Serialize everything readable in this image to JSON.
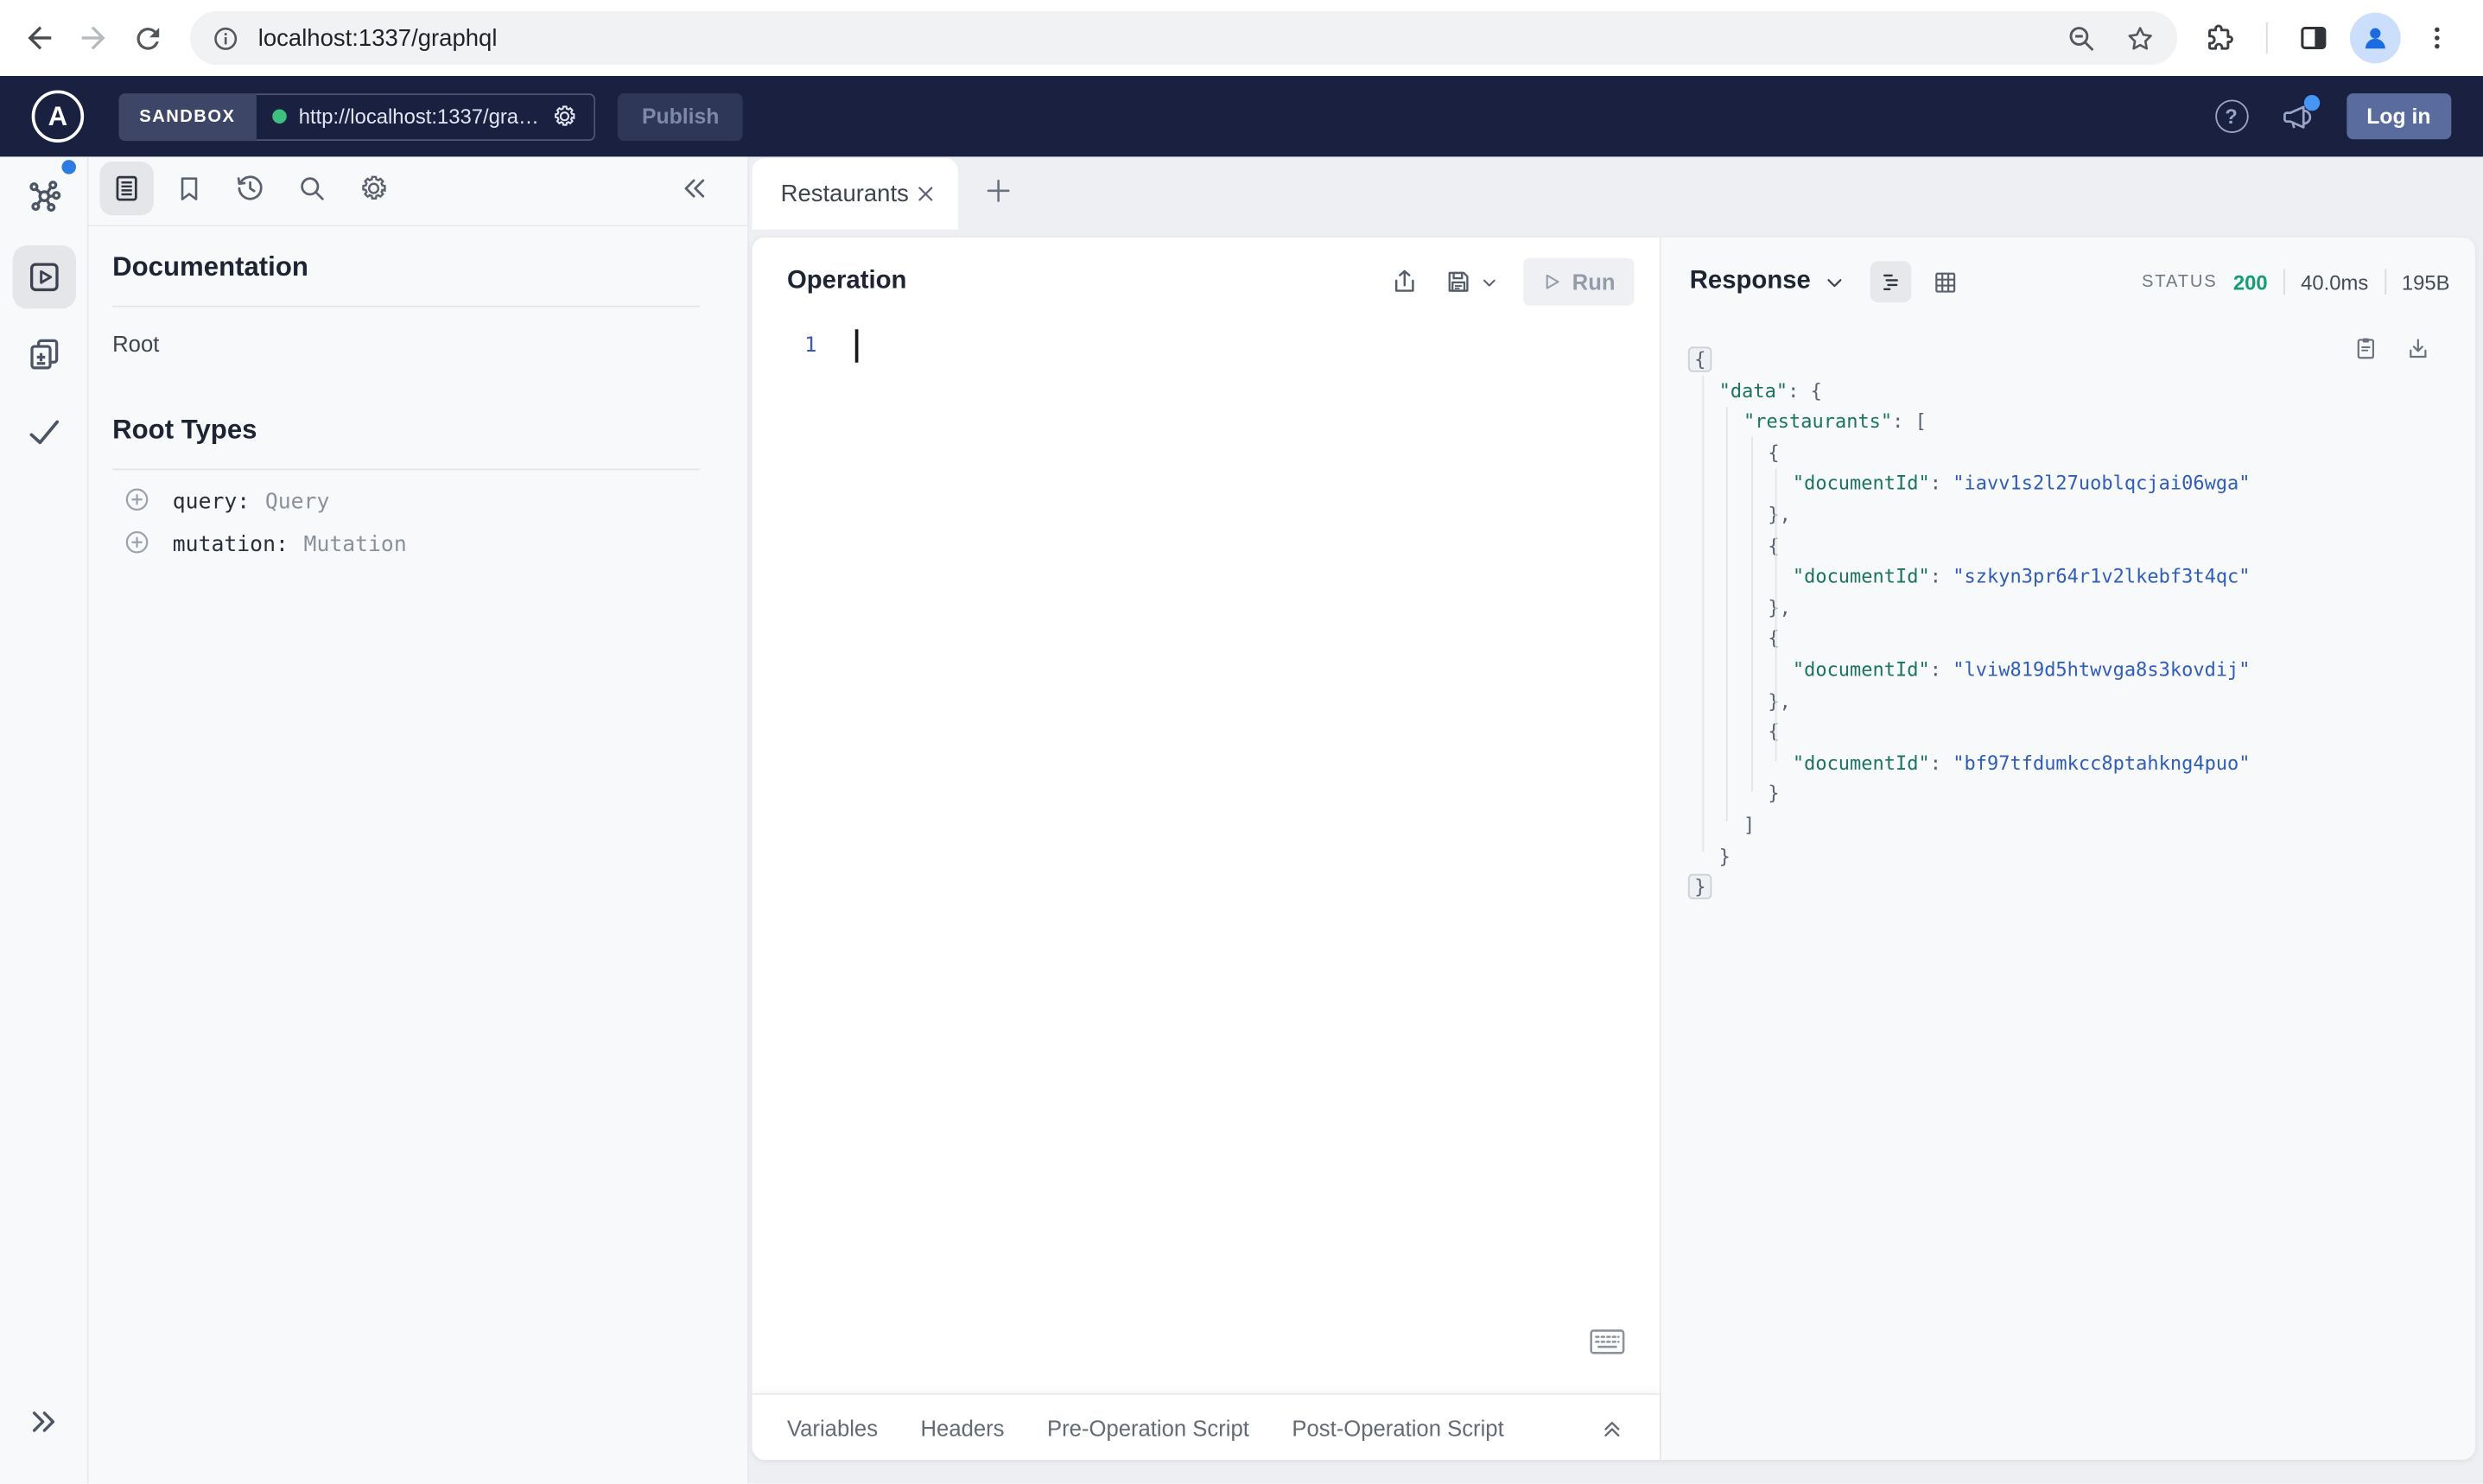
{
  "browser": {
    "url": "localhost:1337/graphql"
  },
  "apollo_bar": {
    "logo_letter": "A",
    "env_label": "SANDBOX",
    "endpoint_url": "http://localhost:1337/gra…",
    "publish_label": "Publish",
    "help_label": "?",
    "login_label": "Log in"
  },
  "docs_panel": {
    "title": "Documentation",
    "root_link": "Root",
    "root_types_title": "Root Types",
    "fields": [
      {
        "name": "query:",
        "type": "Query"
      },
      {
        "name": "mutation:",
        "type": "Mutation"
      }
    ]
  },
  "tabs": {
    "active_tab": "Restaurants"
  },
  "operation_panel": {
    "title": "Operation",
    "run_label": "Run",
    "line_number": "1",
    "drawer_tabs": [
      "Variables",
      "Headers",
      "Pre-Operation Script",
      "Post-Operation Script"
    ]
  },
  "response_panel": {
    "title": "Response",
    "status_label": "STATUS",
    "status_code": "200",
    "duration": "40.0ms",
    "size": "195B",
    "document_ids": [
      "iavv1s2l27uoblqcjai06wga",
      "szkyn3pr64r1v2lkebf3t4qc",
      "lviw819d5htwvga8s3kovdij",
      "bf97tfdumkcc8ptahkng4puo"
    ],
    "json_lines": [
      {
        "indent": 0,
        "fold": true,
        "t": [
          [
            "p",
            "{"
          ]
        ]
      },
      {
        "indent": 1,
        "t": [
          [
            "k",
            "\"data\""
          ],
          [
            "p",
            ": {"
          ]
        ]
      },
      {
        "indent": 2,
        "t": [
          [
            "k",
            "\"restaurants\""
          ],
          [
            "p",
            ": ["
          ]
        ]
      },
      {
        "indent": 3,
        "t": [
          [
            "p",
            "{"
          ]
        ]
      },
      {
        "indent": 4,
        "t": [
          [
            "k",
            "\"documentId\""
          ],
          [
            "p",
            ": "
          ],
          [
            "s",
            "\"iavv1s2l27uoblqcjai06wga\""
          ]
        ]
      },
      {
        "indent": 3,
        "t": [
          [
            "p",
            "},"
          ]
        ]
      },
      {
        "indent": 3,
        "t": [
          [
            "p",
            "{"
          ]
        ]
      },
      {
        "indent": 4,
        "t": [
          [
            "k",
            "\"documentId\""
          ],
          [
            "p",
            ": "
          ],
          [
            "s",
            "\"szkyn3pr64r1v2lkebf3t4qc\""
          ]
        ]
      },
      {
        "indent": 3,
        "t": [
          [
            "p",
            "},"
          ]
        ]
      },
      {
        "indent": 3,
        "t": [
          [
            "p",
            "{"
          ]
        ]
      },
      {
        "indent": 4,
        "t": [
          [
            "k",
            "\"documentId\""
          ],
          [
            "p",
            ": "
          ],
          [
            "s",
            "\"lviw819d5htwvga8s3kovdij\""
          ]
        ]
      },
      {
        "indent": 3,
        "t": [
          [
            "p",
            "},"
          ]
        ]
      },
      {
        "indent": 3,
        "t": [
          [
            "p",
            "{"
          ]
        ]
      },
      {
        "indent": 4,
        "t": [
          [
            "k",
            "\"documentId\""
          ],
          [
            "p",
            ": "
          ],
          [
            "s",
            "\"bf97tfdumkcc8ptahkng4puo\""
          ]
        ]
      },
      {
        "indent": 3,
        "t": [
          [
            "p",
            "}"
          ]
        ]
      },
      {
        "indent": 2,
        "t": [
          [
            "p",
            "]"
          ]
        ]
      },
      {
        "indent": 1,
        "t": [
          [
            "p",
            "}"
          ]
        ]
      },
      {
        "indent": 0,
        "fold": true,
        "t": [
          [
            "p",
            "}"
          ]
        ]
      }
    ]
  },
  "colors": {
    "apollo_navy": "#1a2040",
    "sandbox_chip": "#3e4668",
    "connected_green": "#3fbf7f",
    "login_blue": "#5a6b9e",
    "status_green": "#159e71",
    "json_key_teal": "#1b7463",
    "json_value_blue": "#2e5dba",
    "rail_accent_blue": "#2e7ce0",
    "panel_bg": "#f8f9fb"
  }
}
